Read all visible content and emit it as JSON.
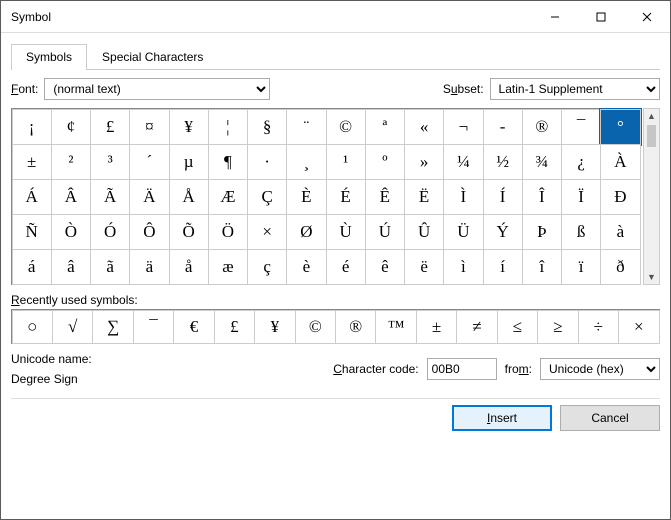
{
  "window": {
    "title": "Symbol"
  },
  "tabs": {
    "symbols": "Symbols",
    "special": "Special Characters"
  },
  "fontRow": {
    "label": "Font:",
    "value": "(normal text)",
    "subsetLabel": "Subset:",
    "subsetValue": "Latin-1 Supplement"
  },
  "grid": {
    "selectedIndex": 15,
    "rows": [
      [
        "¡",
        "¢",
        "£",
        "¤",
        "¥",
        "¦",
        "§",
        "¨",
        "©",
        "ª",
        "«",
        "¬",
        "-",
        "®",
        "¯",
        "°"
      ],
      [
        "±",
        "²",
        "³",
        "´",
        "µ",
        "¶",
        "·",
        "¸",
        "¹",
        "º",
        "»",
        "¼",
        "½",
        "¾",
        "¿",
        "À"
      ],
      [
        "Á",
        "Â",
        "Ã",
        "Ä",
        "Å",
        "Æ",
        "Ç",
        "È",
        "É",
        "Ê",
        "Ë",
        "Ì",
        "Í",
        "Î",
        "Ï",
        "Ð"
      ],
      [
        "Ñ",
        "Ò",
        "Ó",
        "Ô",
        "Õ",
        "Ö",
        "×",
        "Ø",
        "Ù",
        "Ú",
        "Û",
        "Ü",
        "Ý",
        "Þ",
        "ß",
        "à"
      ],
      [
        "á",
        "â",
        "ã",
        "ä",
        "å",
        "æ",
        "ç",
        "è",
        "é",
        "ê",
        "ë",
        "ì",
        "í",
        "î",
        "ï",
        "ð"
      ]
    ]
  },
  "recent": {
    "label": "Recently used symbols:",
    "items": [
      "○",
      "√",
      "∑",
      "¯",
      "€",
      "£",
      "¥",
      "©",
      "®",
      "™",
      "±",
      "≠",
      "≤",
      "≥",
      "÷",
      "×"
    ]
  },
  "unicode": {
    "nameLabel": "Unicode name:",
    "nameValue": "Degree Sign",
    "codeLabel": "Character code:",
    "codeValue": "00B0",
    "fromLabel": "from:",
    "fromValue": "Unicode (hex)"
  },
  "buttons": {
    "insert": "Insert",
    "cancel": "Cancel"
  }
}
